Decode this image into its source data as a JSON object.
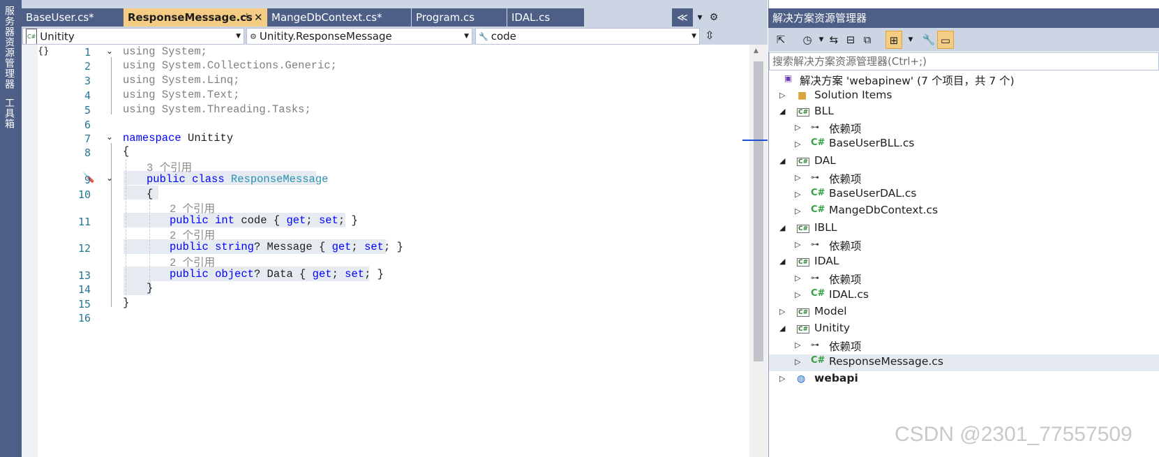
{
  "left_strip": {
    "labels": [
      "服务器资源管理器",
      "工具箱"
    ]
  },
  "tabs": [
    {
      "label": "BaseUser.cs*",
      "active": false
    },
    {
      "label": "ResponseMessage.cs",
      "active": true,
      "pin": "⊣",
      "close": "✕"
    },
    {
      "label": "MangeDbContext.cs*",
      "active": false
    },
    {
      "label": "Program.cs",
      "active": false
    },
    {
      "label": "IDAL.cs",
      "active": false
    }
  ],
  "tab_controls": {
    "overflow": "≪",
    "dropdown": "▾",
    "settings": "⚙"
  },
  "nav": {
    "project": "Unitity",
    "type": "Unitity.ResponseMessage",
    "member": "code",
    "split_icon": "split-icon"
  },
  "editor": {
    "line_numbers": [
      "1",
      "2",
      "3",
      "4",
      "5",
      "6",
      "7",
      "8",
      "9",
      "10",
      "11",
      "12",
      "13",
      "14",
      "15",
      "16"
    ],
    "lines": {
      "l1_kw": "using",
      "l1_rest": " System;",
      "l2_kw": "using",
      "l2_rest": " System.Collections.Generic;",
      "l3_kw": "using",
      "l3_rest": " System.Linq;",
      "l4_kw": "using",
      "l4_rest": " System.Text;",
      "l5_kw": "using",
      "l5_rest": " System.Threading.Tasks;",
      "l7_kw": "namespace",
      "l7_rest": " Unitity",
      "l8": "{",
      "ref9": "3 个引用",
      "l9_kw1": "public",
      "l9_kw2": " class",
      "l9_ty": " ResponseMessage",
      "l10": "{",
      "ref11": "2 个引用",
      "l11_kw1": "public",
      "l11_kw2": " int",
      "l11_name": " code",
      "l11_b1": " { ",
      "l11_get": "get",
      "l11_s1": "; ",
      "l11_set": "set",
      "l11_b2": "; }",
      "ref12": "2 个引用",
      "l12_kw1": "public",
      "l12_kw2": " string",
      "l12_rest": "? Message",
      "l12_b1": " { ",
      "l12_get": "get",
      "l12_s1": "; ",
      "l12_set": "set",
      "l12_b2": "; }",
      "ref13": "2 个引用",
      "l13_kw1": "public",
      "l13_kw2": " object",
      "l13_rest": "? Data",
      "l13_b1": " { ",
      "l13_get": "get",
      "l13_s1": "; ",
      "l13_set": "set",
      "l13_b2": "; }",
      "l14": "}",
      "l15": "}"
    }
  },
  "solution_explorer": {
    "title": "解决方案资源管理器",
    "search_placeholder": "搜索解决方案资源管理器(Ctrl+;)",
    "solution": "解决方案 'webapinew' (7 个项目，共 7 个)",
    "items": [
      {
        "label": "Solution Items"
      },
      {
        "label": "BLL"
      },
      {
        "label": "依赖项"
      },
      {
        "label": "BaseUserBLL.cs"
      },
      {
        "label": "DAL"
      },
      {
        "label": "依赖项"
      },
      {
        "label": "BaseUserDAL.cs"
      },
      {
        "label": "MangeDbContext.cs"
      },
      {
        "label": "IBLL"
      },
      {
        "label": "依赖项"
      },
      {
        "label": "IDAL"
      },
      {
        "label": "依赖项"
      },
      {
        "label": "IDAL.cs"
      },
      {
        "label": "Model"
      },
      {
        "label": "Unitity"
      },
      {
        "label": "依赖项"
      },
      {
        "label": "ResponseMessage.cs"
      },
      {
        "label": "webapi"
      }
    ]
  },
  "watermark": "CSDN @2301_77557509",
  "colors": {
    "accent": "#f5cc84",
    "chrome": "#4d5f86",
    "keyword": "#0000ff",
    "type": "#2b91af"
  }
}
